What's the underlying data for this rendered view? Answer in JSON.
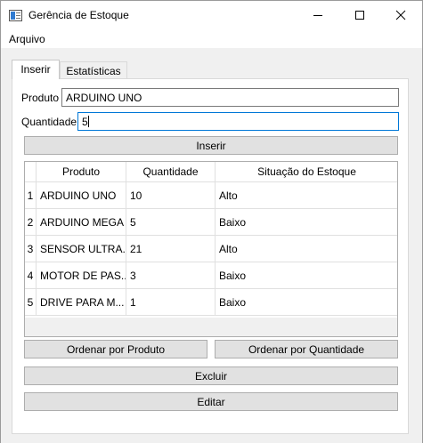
{
  "window": {
    "title": "Gerência de Estoque"
  },
  "menu": {
    "arquivo": "Arquivo"
  },
  "tabs": [
    {
      "label": "Inserir",
      "active": true
    },
    {
      "label": "Estatísticas",
      "active": false
    }
  ],
  "form": {
    "produto_label": "Produto",
    "produto_value": "ARDUINO UNO",
    "quantidade_label": "Quantidade",
    "quantidade_value": "5"
  },
  "buttons": {
    "inserir": "Inserir",
    "ordenar_produto": "Ordenar por Produto",
    "ordenar_quantidade": "Ordenar por Quantidade",
    "excluir": "Excluir",
    "editar": "Editar"
  },
  "table": {
    "headers": [
      "Produto",
      "Quantidade",
      "Situação do Estoque"
    ],
    "rows": [
      {
        "num": "1",
        "produto": "ARDUINO UNO",
        "quantidade": "10",
        "situacao": "Alto"
      },
      {
        "num": "2",
        "produto": "ARDUINO MEGA",
        "quantidade": "5",
        "situacao": "Baixo"
      },
      {
        "num": "3",
        "produto": "SENSOR ULTRA...",
        "quantidade": "21",
        "situacao": "Alto"
      },
      {
        "num": "4",
        "produto": "MOTOR DE PAS...",
        "quantidade": "3",
        "situacao": "Baixo"
      },
      {
        "num": "5",
        "produto": "DRIVE PARA M...",
        "quantidade": "1",
        "situacao": "Baixo"
      }
    ]
  },
  "colors": {
    "accent": "#0078d7",
    "button_bg": "#e1e1e1",
    "panel_bg": "#f0f0f0"
  }
}
